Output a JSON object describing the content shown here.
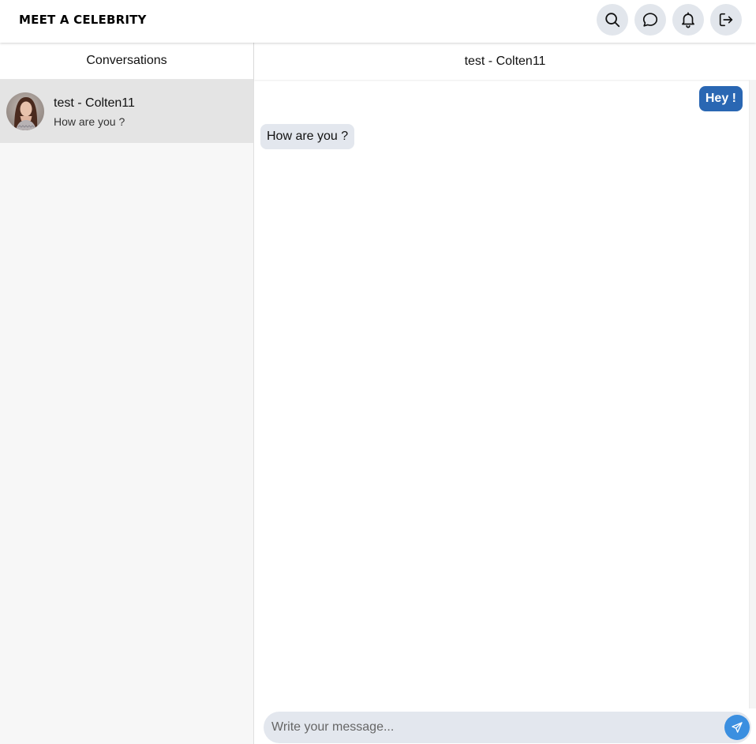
{
  "app": {
    "title": "MEET A CELEBRITY"
  },
  "nav": {
    "buttons": [
      {
        "name": "search",
        "icon": "search-icon"
      },
      {
        "name": "messages",
        "icon": "chat-bubble-icon"
      },
      {
        "name": "notifications",
        "icon": "bell-icon"
      },
      {
        "name": "logout",
        "icon": "logout-icon"
      }
    ]
  },
  "sidebar": {
    "title": "Conversations",
    "conversations": [
      {
        "name": "test - Colten11",
        "preview": "How are you ?",
        "avatar": "avatar-photo"
      }
    ]
  },
  "chat": {
    "title": "test - Colten11",
    "messages": [
      {
        "direction": "outgoing",
        "text": "Hey !"
      },
      {
        "direction": "incoming",
        "text": "How are you ?"
      }
    ],
    "composer": {
      "placeholder": "Write your message...",
      "value": ""
    }
  },
  "colors": {
    "accent": "#2a67b3",
    "send": "#3b8fe0",
    "bubble_in": "#e3e7ee",
    "nav_button": "#e2e6ec"
  }
}
